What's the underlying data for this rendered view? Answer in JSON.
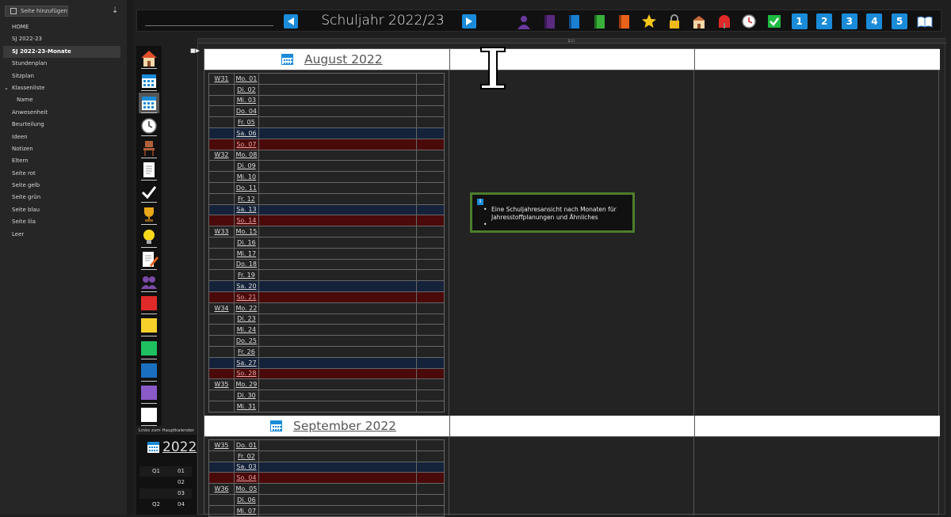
{
  "sidebar": {
    "add_page_label": "Seite hinzufügen",
    "items": [
      {
        "label": "HOME"
      },
      {
        "label": "SJ 2022-23"
      },
      {
        "label": "SJ 2022-23-Monate",
        "active": true
      },
      {
        "label": "Stundenplan"
      },
      {
        "label": "Sitzplan"
      },
      {
        "label": "Klassenliste",
        "expanded": true
      },
      {
        "label": "Name",
        "sub": true
      },
      {
        "label": "Anwesenheit"
      },
      {
        "label": "Beurteilung"
      },
      {
        "label": "Ideen"
      },
      {
        "label": "Notizen"
      },
      {
        "label": "Eltern"
      },
      {
        "label": "Seite rot"
      },
      {
        "label": "Seite gelb"
      },
      {
        "label": "Seite grün"
      },
      {
        "label": "Seite blau"
      },
      {
        "label": "Seite lila"
      },
      {
        "label": "Leer"
      }
    ]
  },
  "header": {
    "title": "Schuljahr 2022/23",
    "icons": [
      "person-icon",
      "purple-book-icon",
      "blue-book-icon",
      "green-book-icon",
      "orange-book-icon",
      "star-icon",
      "lock-icon",
      "school-icon",
      "mailbox-icon",
      "clock-icon",
      "checkmark-icon",
      "number-1-icon",
      "number-2-icon",
      "number-3-icon",
      "number-4-icon",
      "number-5-icon",
      "open-book-icon"
    ],
    "numbers": [
      "1",
      "2",
      "3",
      "4",
      "5"
    ]
  },
  "icon_column": [
    "home-icon",
    "calendar-icon",
    "calendar-icon",
    "clock-icon",
    "chair-icon",
    "document-icon",
    "checkmark-icon",
    "trophy-icon",
    "lightbulb-icon",
    "memo-icon",
    "people-icon",
    "red-square-icon",
    "yellow-square-icon",
    "green-square-icon",
    "blue-square-icon",
    "purple-square-icon",
    "white-square-icon"
  ],
  "mini_calendar": {
    "links_label": "Links zum Hauptkalender",
    "year": "2022",
    "rows": [
      {
        "q": "Q1",
        "m": "01"
      },
      {
        "q": "",
        "m": "02"
      },
      {
        "q": "",
        "m": "03"
      },
      {
        "q": "Q2",
        "m": "04"
      }
    ]
  },
  "months": [
    {
      "title": "August 2022",
      "rows": [
        {
          "wk": "W31",
          "day": "Mo. 01",
          "t": ""
        },
        {
          "wk": "",
          "day": "Di. 02",
          "t": ""
        },
        {
          "wk": "",
          "day": "Mi. 03",
          "t": ""
        },
        {
          "wk": "",
          "day": "Do. 04",
          "t": ""
        },
        {
          "wk": "",
          "day": "Fr. 05",
          "t": ""
        },
        {
          "wk": "",
          "day": "Sa. 06",
          "t": "sat"
        },
        {
          "wk": "",
          "day": "So. 07",
          "t": "sun"
        },
        {
          "wk": "W32",
          "day": "Mo. 08",
          "t": ""
        },
        {
          "wk": "",
          "day": "Di. 09",
          "t": ""
        },
        {
          "wk": "",
          "day": "Mi. 10",
          "t": ""
        },
        {
          "wk": "",
          "day": "Do. 11",
          "t": ""
        },
        {
          "wk": "",
          "day": "Fr. 12",
          "t": ""
        },
        {
          "wk": "",
          "day": "Sa. 13",
          "t": "sat"
        },
        {
          "wk": "",
          "day": "So. 14",
          "t": "sun"
        },
        {
          "wk": "W33",
          "day": "Mo. 15",
          "t": ""
        },
        {
          "wk": "",
          "day": "Di. 16",
          "t": ""
        },
        {
          "wk": "",
          "day": "Mi. 17",
          "t": ""
        },
        {
          "wk": "",
          "day": "Do. 18",
          "t": ""
        },
        {
          "wk": "",
          "day": "Fr. 19",
          "t": ""
        },
        {
          "wk": "",
          "day": "Sa. 20",
          "t": "sat"
        },
        {
          "wk": "",
          "day": "So. 21",
          "t": "sun"
        },
        {
          "wk": "W34",
          "day": "Mo. 22",
          "t": ""
        },
        {
          "wk": "",
          "day": "Di. 23",
          "t": ""
        },
        {
          "wk": "",
          "day": "Mi. 24",
          "t": ""
        },
        {
          "wk": "",
          "day": "Do. 25",
          "t": ""
        },
        {
          "wk": "",
          "day": "Fr. 26",
          "t": ""
        },
        {
          "wk": "",
          "day": "Sa. 27",
          "t": "sat"
        },
        {
          "wk": "",
          "day": "So. 28",
          "t": "sun"
        },
        {
          "wk": "W35",
          "day": "Mo. 29",
          "t": ""
        },
        {
          "wk": "",
          "day": "Di. 30",
          "t": ""
        },
        {
          "wk": "",
          "day": "Mi. 31",
          "t": ""
        }
      ]
    },
    {
      "title": "September 2022",
      "rows": [
        {
          "wk": "W35",
          "day": "Do. 01",
          "t": ""
        },
        {
          "wk": "",
          "day": "Fr. 02",
          "t": ""
        },
        {
          "wk": "",
          "day": "Sa. 03",
          "t": "sat"
        },
        {
          "wk": "",
          "day": "So. 04",
          "t": "sun"
        },
        {
          "wk": "W36",
          "day": "Mo. 05",
          "t": ""
        },
        {
          "wk": "",
          "day": "Di. 06",
          "t": ""
        },
        {
          "wk": "",
          "day": "Mi. 07",
          "t": ""
        }
      ]
    }
  ],
  "note": {
    "items": [
      "Eine Schuljahresansicht nach Monaten für Jahresstoffplanungen und Ähnliches",
      ""
    ]
  },
  "colors": {
    "accent": "#1a8bd8",
    "note_border": "#4d7d2d",
    "saturday": "#14223a",
    "sunday": "#4a0a0a"
  }
}
